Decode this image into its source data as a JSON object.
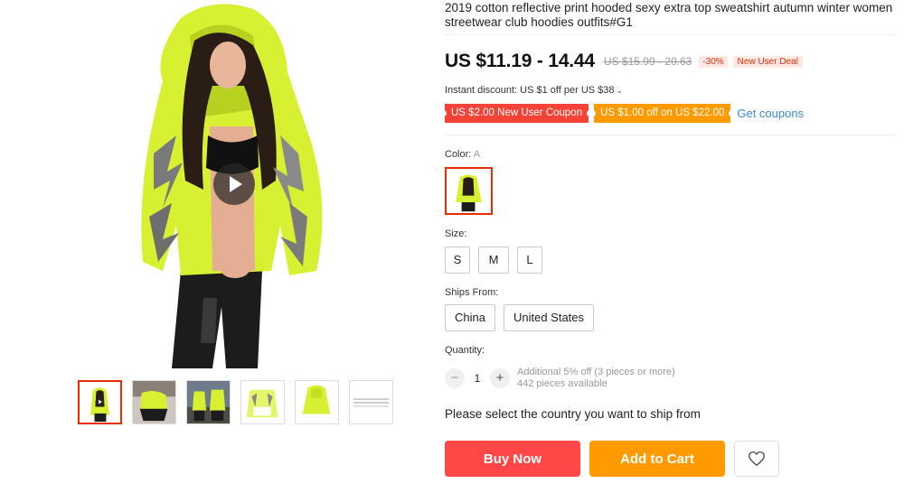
{
  "product": {
    "title": "2019 cotton reflective print hooded sexy extra top sweatshirt autumn winter women streetwear club hoodies outfits#G1"
  },
  "price": {
    "current": "US $11.19 - 14.44",
    "original": "US $15.99 - 20.63",
    "discount": "-30%",
    "deal_badge": "New User Deal"
  },
  "instant_discount": {
    "text": "Instant discount: US $1 off per US $38",
    "chevron_icon": "chevron-down-icon"
  },
  "coupons": {
    "items": [
      {
        "label": "US $2.00 New User Coupon",
        "color": "#f44336"
      },
      {
        "label": "US $1.00 off on US $22.00",
        "color": "#ff9a00"
      }
    ],
    "get_label": "Get coupons"
  },
  "color": {
    "label": "Color:",
    "selected": "A"
  },
  "size": {
    "label": "Size:",
    "options": [
      "S",
      "M",
      "L"
    ]
  },
  "ships_from": {
    "label": "Ships From:",
    "options": [
      "China",
      "United States"
    ]
  },
  "quantity": {
    "label": "Quantity:",
    "value": "1",
    "minus": "−",
    "plus": "+",
    "note": "Additional 5% off (3 pieces or more)",
    "available": "442 pieces available"
  },
  "ship_note": "Please select the country you want to ship from",
  "actions": {
    "buy_now": "Buy Now",
    "add_to_cart": "Add to Cart",
    "wishlist_icon": "heart-icon"
  },
  "gallery": {
    "video_icon": "play-icon",
    "thumb_count": 6
  },
  "theme": {
    "accent_red": "#ff4747",
    "accent_orange": "#ff9a00",
    "link_blue": "#3b8ad9",
    "garment_green": "#d7f032"
  }
}
